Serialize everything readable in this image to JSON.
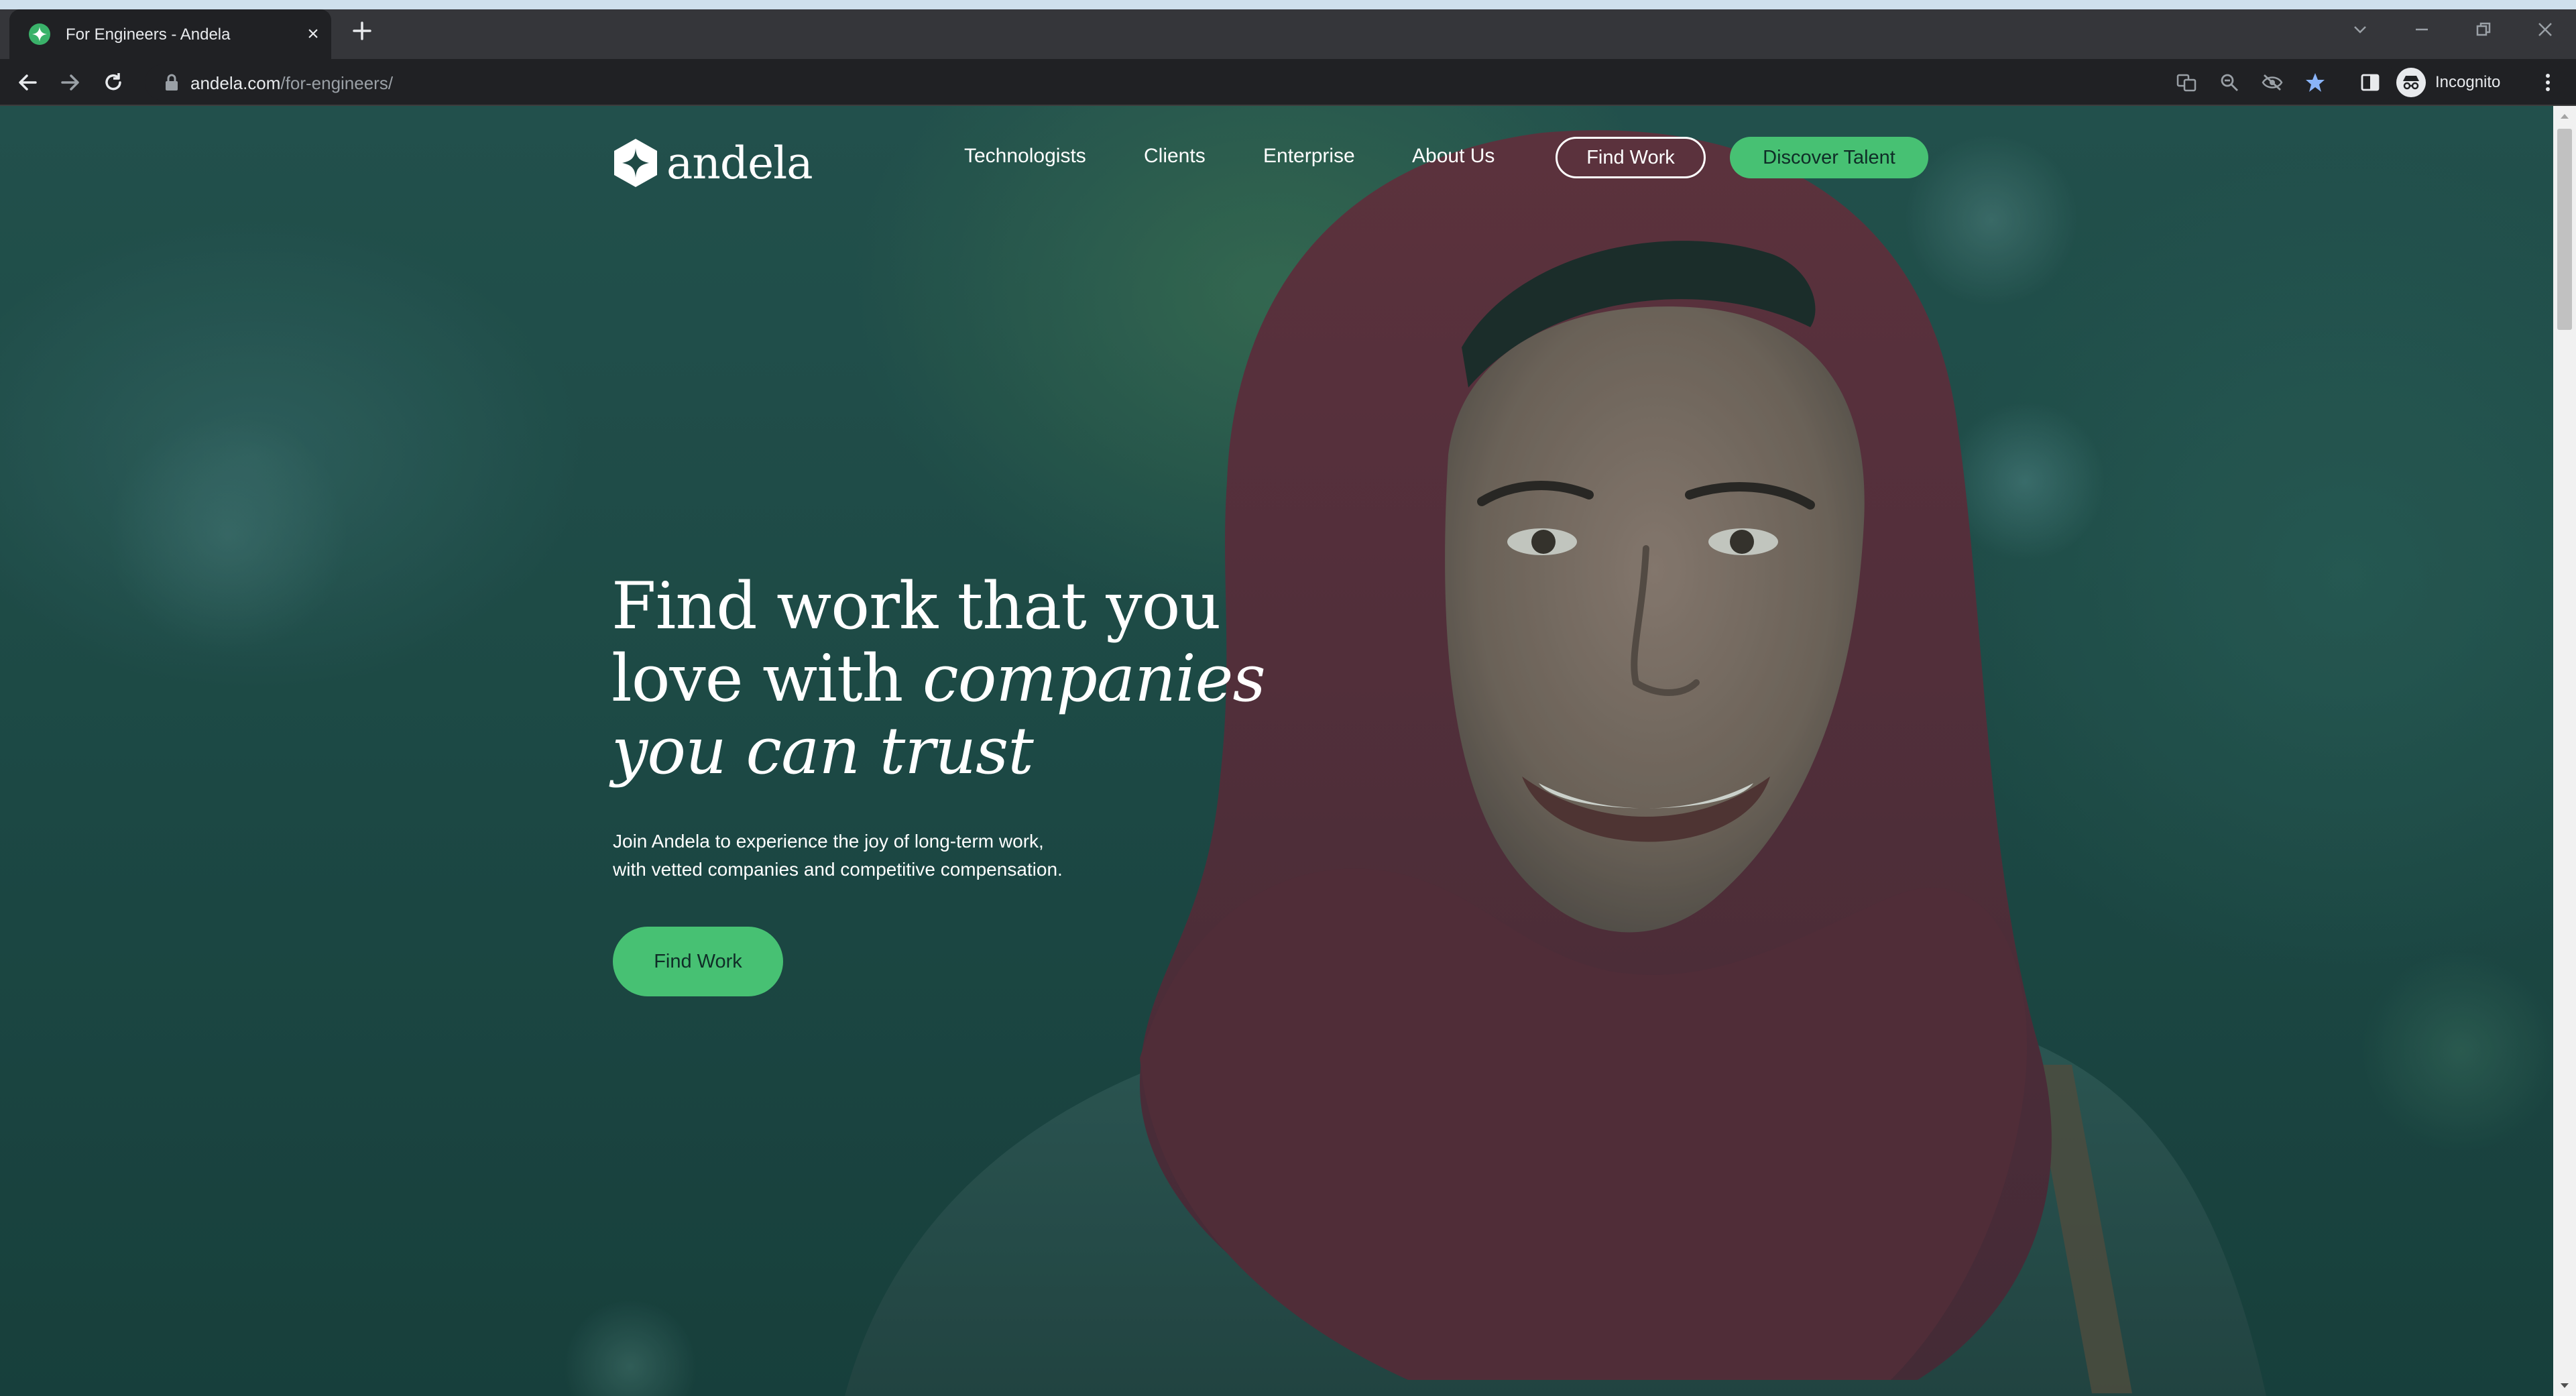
{
  "browser": {
    "tab": {
      "title": "For Engineers - Andela",
      "close_glyph": "×",
      "favicon": "andela-favicon-icon"
    },
    "address": {
      "host": "andela.com",
      "path": "/for-engineers/"
    },
    "profile_label": "Incognito",
    "toolbar_icons": [
      "translate-icon",
      "zoom-icon",
      "eye-off-icon",
      "bookmark-star-icon",
      "side-panel-icon",
      "incognito-icon",
      "menu-icon"
    ]
  },
  "site": {
    "logo_text": "andela",
    "nav": {
      "links": [
        "Technologists",
        "Clients",
        "Enterprise",
        "About Us"
      ],
      "find_work": "Find Work",
      "discover_talent": "Discover Talent"
    },
    "hero": {
      "title_line1": "Find work that you",
      "title_line2_plain": "love with ",
      "title_line2_italic": "companies",
      "title_line3_italic": "you can trust",
      "subtitle_line1": "Join Andela to experience the joy of long-term work,",
      "subtitle_line2": "with vetted companies and competitive compensation.",
      "cta": "Find Work"
    }
  },
  "colors": {
    "brand_green": "#47c173",
    "hero_overlay": "#1f4a45",
    "chrome_dark": "#202124",
    "scarf": "#6e2a3a"
  }
}
